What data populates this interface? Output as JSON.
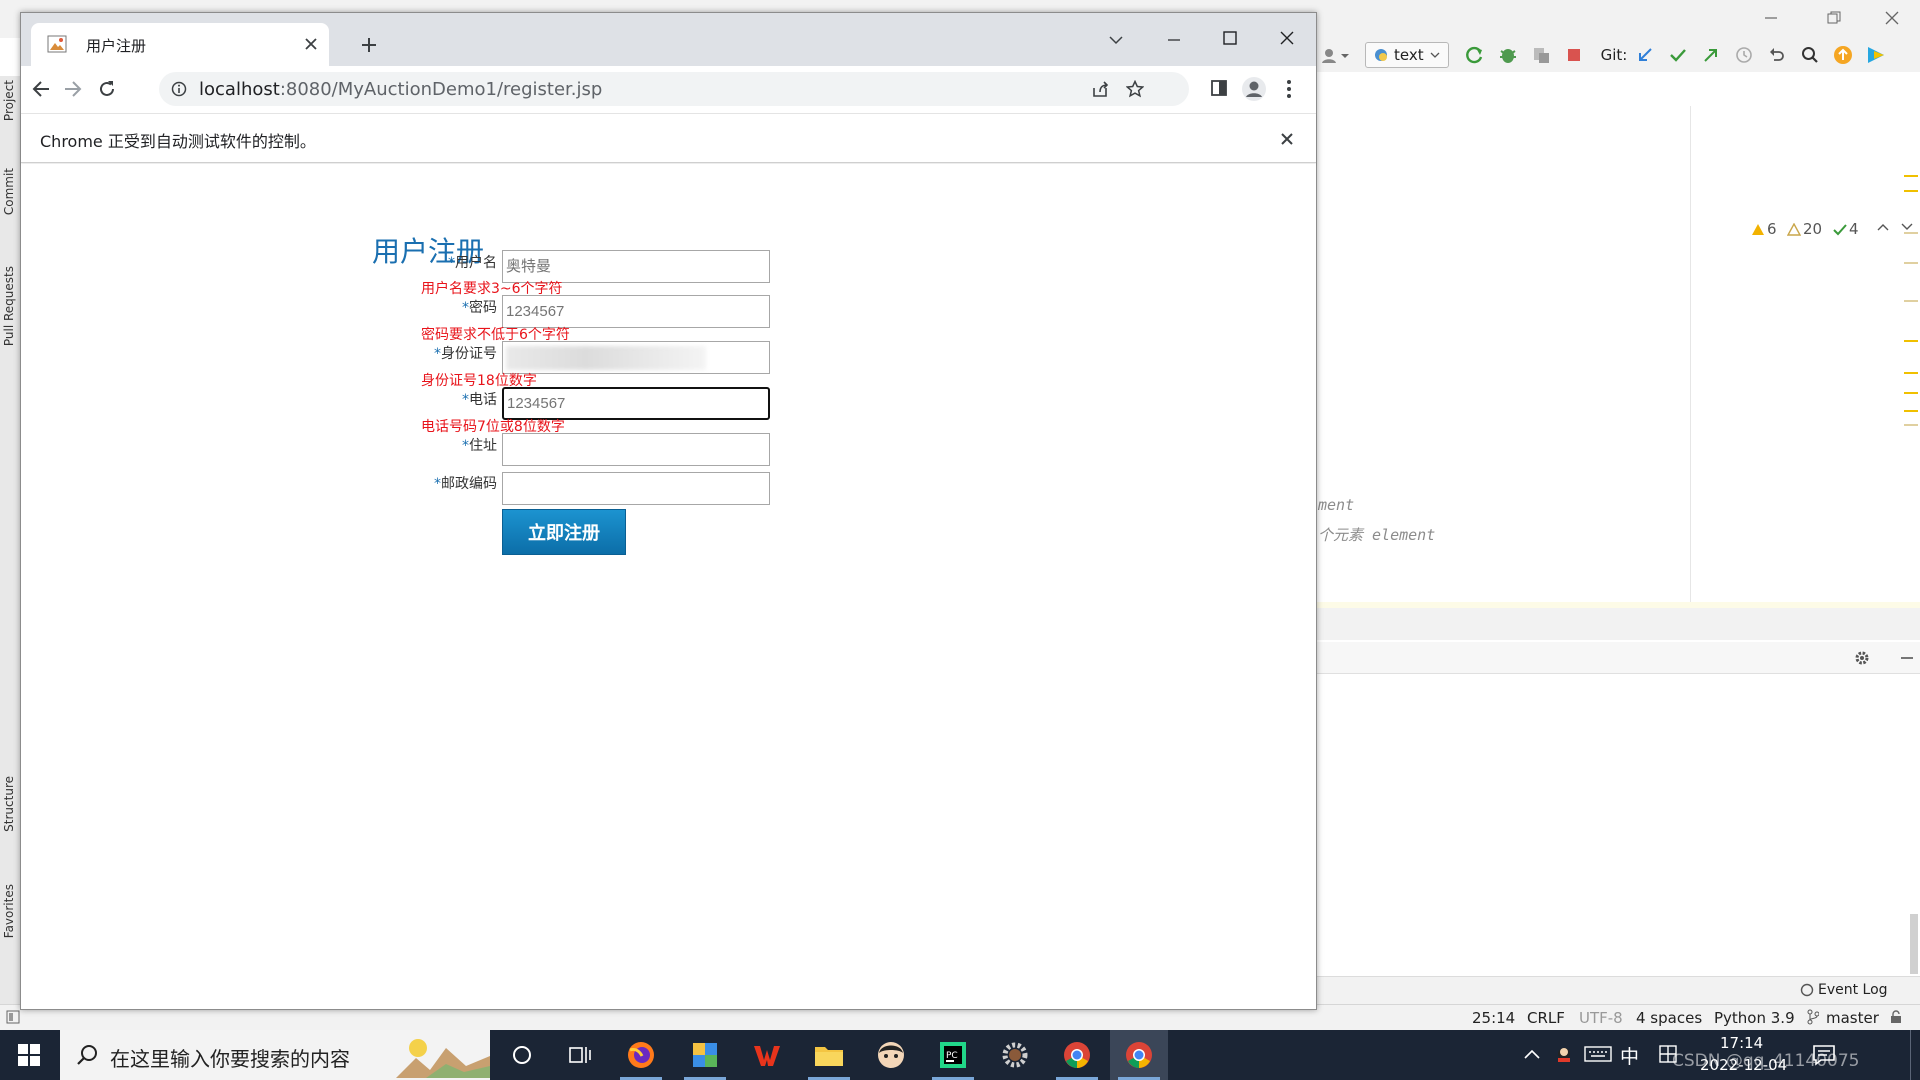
{
  "browser": {
    "tab_title": "用户注册",
    "url_host": "localhost",
    "url_rest": ":8080/MyAuctionDemo1/register.jsp",
    "infobar_text": "Chrome 正受到自动测试软件的控制。"
  },
  "form": {
    "title": "用户注册",
    "required_mark": "*",
    "fields": [
      {
        "label": "用户名",
        "value": "奥特曼",
        "error": "用户名要求3~6个字符"
      },
      {
        "label": "密码",
        "value": "1234567",
        "error": "密码要求不低于6个字符"
      },
      {
        "label": "身份证号",
        "value": "7333855",
        "error": "身份证号18位数字"
      },
      {
        "label": "电话",
        "value": "1234567",
        "error": "电话号码7位或8位数字"
      },
      {
        "label": "住址",
        "value": "",
        "error": ""
      },
      {
        "label": "邮政编码",
        "value": "",
        "error": ""
      }
    ],
    "submit_label": "立即注册"
  },
  "ide": {
    "run_config": "text",
    "git_label": "Git:",
    "left_tools": [
      "Project",
      "Commit",
      "Pull Requests",
      "Structure",
      "Favorites"
    ],
    "inspections": {
      "warnings": "6",
      "weak_warnings": "20",
      "ok": "4"
    },
    "code_comment_1": "ment",
    "code_comment_2": "个元素 element",
    "event_log": "Event Log",
    "status": {
      "position": "25:14",
      "line_sep": "CRLF",
      "encoding": "UTF-8",
      "indent": "4 spaces",
      "interpreter": "Python 3.9",
      "branch": "master"
    }
  },
  "taskbar": {
    "search_placeholder": "在这里输入你要搜索的内容",
    "ime": "中",
    "time": "17:14",
    "date": "2022-12-04",
    "watermark": "CSDN @qq_41140075"
  }
}
